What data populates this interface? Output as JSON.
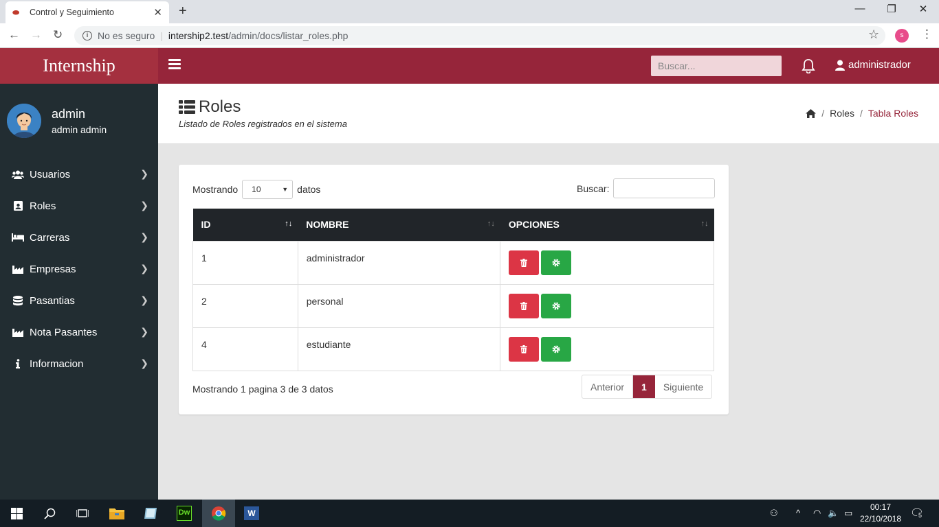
{
  "browser": {
    "tab_title": "Control y Seguimiento",
    "security_label": "No es seguro",
    "url_host": "intership2.test",
    "url_path": "/admin/docs/listar_roles.php",
    "profile_initial": "s"
  },
  "app": {
    "brand": "Internship",
    "search_placeholder": "Buscar...",
    "user_menu_label": "administrador",
    "colors": {
      "brand": "#a4303f",
      "topbar": "#96253a",
      "sidebar": "#222d32",
      "danger": "#dc3545",
      "success": "#28a745"
    }
  },
  "sidebar": {
    "user_name": "admin",
    "user_fullname": "admin admin",
    "items": [
      {
        "label": "Usuarios",
        "icon": "users-icon"
      },
      {
        "label": "Roles",
        "icon": "id-card-icon"
      },
      {
        "label": "Carreras",
        "icon": "bed-icon"
      },
      {
        "label": "Empresas",
        "icon": "industry-icon"
      },
      {
        "label": "Pasantias",
        "icon": "database-icon"
      },
      {
        "label": "Nota Pasantes",
        "icon": "industry-icon"
      },
      {
        "label": "Informacion",
        "icon": "info-icon"
      }
    ]
  },
  "header": {
    "title": "Roles",
    "subtitle": "Listado de Roles registrados en el sistema",
    "breadcrumb": [
      "Roles",
      "Tabla Roles"
    ]
  },
  "table": {
    "length_prefix": "Mostrando",
    "length_value": "10",
    "length_suffix": "datos",
    "search_label": "Buscar:",
    "columns": [
      "ID",
      "NOMBRE",
      "OPCIONES"
    ],
    "rows": [
      {
        "id": "1",
        "nombre": "administrador"
      },
      {
        "id": "2",
        "nombre": "personal"
      },
      {
        "id": "4",
        "nombre": "estudiante"
      }
    ],
    "info": "Mostrando 1 pagina 3 de 3 datos",
    "pagination": {
      "prev": "Anterior",
      "current": "1",
      "next": "Siguiente"
    }
  },
  "taskbar": {
    "time": "00:17",
    "date": "22/10/2018",
    "notifications": "5",
    "apps": [
      "start-icon",
      "search-icon",
      "task-view-icon",
      "file-explorer-icon",
      "edge-like-icon",
      "dreamweaver-icon",
      "chrome-icon",
      "word-icon"
    ],
    "dw_label": "Dw",
    "word_label": "W"
  }
}
